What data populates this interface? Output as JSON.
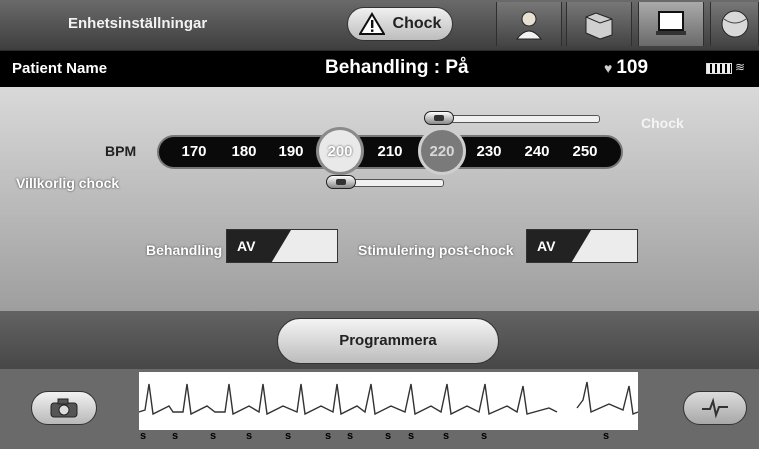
{
  "toolbar": {
    "settings_label": "Enhetsinställningar",
    "shock_label": "Chock",
    "tabs": [
      {
        "icon": "patient-icon"
      },
      {
        "icon": "folder-icon"
      },
      {
        "icon": "monitor-icon"
      },
      {
        "icon": "globe-icon"
      }
    ],
    "active_tab": 2
  },
  "status": {
    "patient_name": "Patient Name",
    "therapy_status": "Behandling : På",
    "heart_rate": "109"
  },
  "panel": {
    "chock_label": "Chock",
    "bpm_label": "BPM",
    "conditional_label": "Villkorlig chock",
    "bpm_values": [
      "170",
      "180",
      "190",
      "200",
      "210",
      "220",
      "230",
      "240",
      "250"
    ],
    "conditional_shock_bpm": "200",
    "shock_bpm": "220"
  },
  "therapy_toggle": {
    "label": "Behandling",
    "value": "AV"
  },
  "post_shock_toggle": {
    "label": "Stimulering post-chock",
    "value": "AV"
  },
  "program_button": "Programmera",
  "ecg_markers": [
    "s",
    "s",
    "s",
    "s",
    "s",
    "s",
    "s",
    "s",
    "s",
    "s",
    "s",
    "s"
  ],
  "colors": {
    "status_bar": "#000000",
    "bpm_bar": "#0a0a0a",
    "panel": "#d9d9d9"
  }
}
